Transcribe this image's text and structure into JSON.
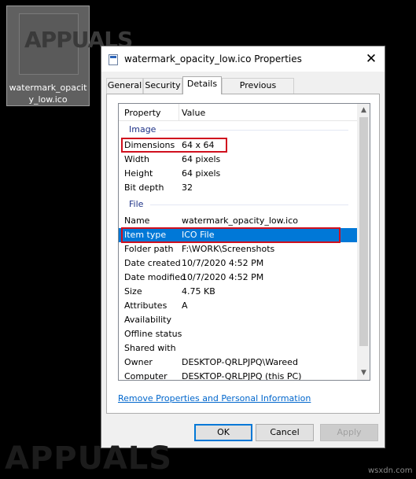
{
  "desktop": {
    "icon_label": "watermark_opacity_low.ico",
    "icon_thumb_text": "APPUALS"
  },
  "dialog": {
    "title": "watermark_opacity_low.ico Properties",
    "close": "✕",
    "tabs": [
      "General",
      "Security",
      "Details",
      "Previous Versions"
    ],
    "active_tab": "Details",
    "columns": [
      "Property",
      "Value"
    ],
    "sections": [
      {
        "group": "Image",
        "rows": [
          {
            "property": "Dimensions",
            "value": "64 x 64"
          },
          {
            "property": "Width",
            "value": "64 pixels"
          },
          {
            "property": "Height",
            "value": "64 pixels"
          },
          {
            "property": "Bit depth",
            "value": "32"
          }
        ]
      },
      {
        "group": "File",
        "rows": [
          {
            "property": "Name",
            "value": "watermark_opacity_low.ico"
          },
          {
            "property": "Item type",
            "value": "ICO File"
          },
          {
            "property": "Folder path",
            "value": "F:\\WORK\\Screenshots"
          },
          {
            "property": "Date created",
            "value": "10/7/2020 4:52 PM"
          },
          {
            "property": "Date modified",
            "value": "10/7/2020 4:52 PM"
          },
          {
            "property": "Size",
            "value": "4.75 KB"
          },
          {
            "property": "Attributes",
            "value": "A"
          },
          {
            "property": "Availability",
            "value": ""
          },
          {
            "property": "Offline status",
            "value": ""
          },
          {
            "property": "Shared with",
            "value": ""
          },
          {
            "property": "Owner",
            "value": "DESKTOP-QRLPJPQ\\Wareed"
          },
          {
            "property": "Computer",
            "value": "DESKTOP-QRLPJPQ (this PC)"
          }
        ]
      }
    ],
    "selected_row": "Item type",
    "highlighted_rows": [
      "Dimensions",
      "Item type"
    ],
    "remove_link": "Remove Properties and Personal Information",
    "buttons": {
      "ok": "OK",
      "cancel": "Cancel",
      "apply": "Apply"
    },
    "colors": {
      "selection": "#0078d7",
      "highlight_box": "#d0101e",
      "group_text": "#1e3287",
      "link": "#0066cc"
    }
  },
  "watermark": "APPUALS",
  "site": "wsxdn.com"
}
